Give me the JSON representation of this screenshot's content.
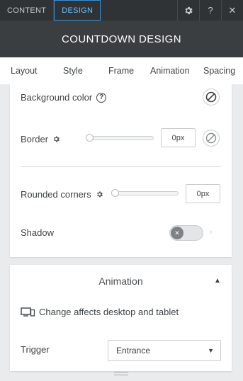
{
  "top_tabs": [
    {
      "label": "CONTENT",
      "active": false
    },
    {
      "label": "DESIGN",
      "active": true
    }
  ],
  "top_icons": [
    "gear-icon",
    "help-icon",
    "close-icon"
  ],
  "top_icon_glyphs": {
    "help": "?",
    "close": "✕"
  },
  "header": {
    "title": "COUNTDOWN DESIGN"
  },
  "sub_tabs": [
    {
      "label": "Layout"
    },
    {
      "label": "Style"
    },
    {
      "label": "Frame",
      "active": true
    },
    {
      "label": "Animation"
    },
    {
      "label": "Spacing"
    }
  ],
  "frame": {
    "background_color": {
      "label": "Background color",
      "help": "?"
    },
    "border": {
      "label": "Border",
      "value": "0px",
      "slider_level": 0
    },
    "rounded_corners": {
      "label": "Rounded corners",
      "value": "0px",
      "slider_level": 0
    },
    "shadow": {
      "label": "Shadow",
      "enabled": false
    }
  },
  "animation_section": {
    "title": "Animation",
    "note": "Change affects desktop and tablet",
    "trigger": {
      "label": "Trigger",
      "selected": "Entrance"
    }
  },
  "colors": {
    "topbar_bg": "#2f3336",
    "header_bg": "#3a3e41",
    "active_tab": "#3b8fd3",
    "page_bg": "#e9ebed"
  }
}
